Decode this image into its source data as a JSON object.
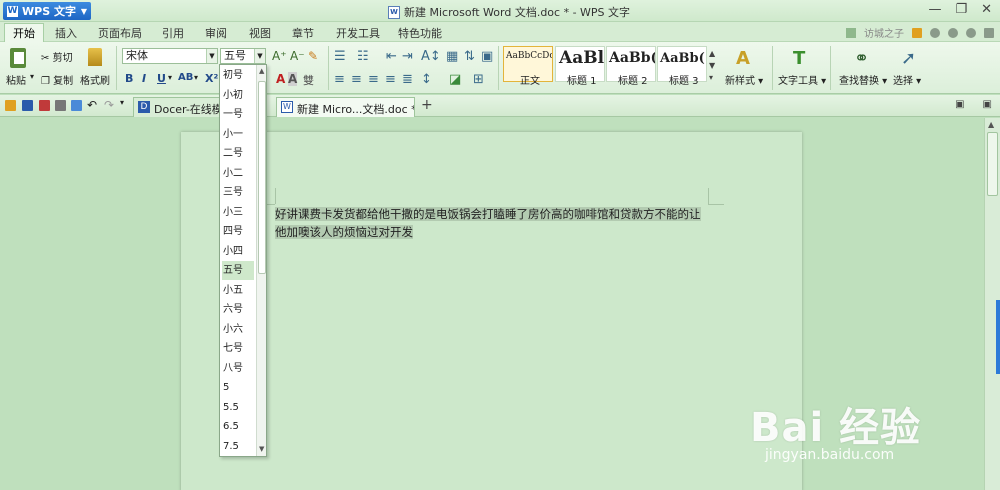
{
  "titlebar": {
    "app_name": "WPS 文字",
    "title": "新建 Microsoft Word 文档.doc * - WPS 文字",
    "controls": [
      "minimize-icon",
      "restore-icon",
      "close-icon"
    ]
  },
  "menu": {
    "tabs": [
      "开始",
      "插入",
      "页面布局",
      "引用",
      "审阅",
      "视图",
      "章节",
      "开发工具",
      "特色功能"
    ],
    "active": "开始",
    "user": "访城之子"
  },
  "ribbon": {
    "paste": "粘贴",
    "cut": "剪切",
    "copy": "复制",
    "format_painter": "格式刷",
    "font_name": "宋体",
    "font_size": "五号",
    "styles": [
      {
        "sample": "AaBbCcDc",
        "label": "正文"
      },
      {
        "sample": "AaBl",
        "label": "标题 1"
      },
      {
        "sample": "AaBb(",
        "label": "标题 2"
      },
      {
        "sample": "AaBb(",
        "label": "标题 3"
      }
    ],
    "new_style": "新样式",
    "text_tools": "文字工具",
    "find_replace": "查找替换",
    "select": "选择"
  },
  "tabs": {
    "items": [
      {
        "label": "Docer-在线模板",
        "active": false
      },
      {
        "label": "新建 Micro...文档.doc *",
        "active": true
      }
    ],
    "new_tab": "+"
  },
  "document": {
    "text": "好讲课费卡发货都给他干撒的是电饭锅会打瞌睡了房价高的咖啡馆和贷款方不能的让他加噢该人的烦恼过对开发"
  },
  "font_size_dropdown": {
    "items": [
      "初号",
      "小初",
      "一号",
      "小一",
      "二号",
      "小二",
      "三号",
      "小三",
      "四号",
      "小四",
      "五号",
      "小五",
      "六号",
      "小六",
      "七号",
      "八号",
      "5",
      "5.5",
      "6.5",
      "7.5"
    ],
    "selected": "五号"
  },
  "watermark": {
    "main": "Bai 经验",
    "sub": "jingyan.baidu.com"
  }
}
